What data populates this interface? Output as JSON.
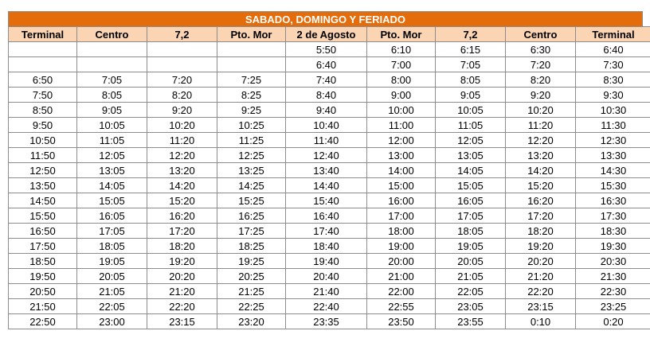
{
  "schedule": {
    "title": "SABADO, DOMINGO Y FERIADO",
    "headers": [
      "Terminal",
      "Centro",
      "7,2",
      "Pto. Mor",
      "2 de Agosto",
      "Pto. Mor",
      "7,2",
      "Centro",
      "Terminal"
    ],
    "rows": [
      [
        "",
        "",
        "",
        "",
        "5:50",
        "6:10",
        "6:15",
        "6:30",
        "6:40"
      ],
      [
        "",
        "",
        "",
        "",
        "6:40",
        "7:00",
        "7:05",
        "7:20",
        "7:30"
      ],
      [
        "6:50",
        "7:05",
        "7:20",
        "7:25",
        "7:40",
        "8:00",
        "8:05",
        "8:20",
        "8:30"
      ],
      [
        "7:50",
        "8:05",
        "8:20",
        "8:25",
        "8:40",
        "9:00",
        "9:05",
        "9:20",
        "9:30"
      ],
      [
        "8:50",
        "9:05",
        "9:20",
        "9:25",
        "9:40",
        "10:00",
        "10:05",
        "10:20",
        "10:30"
      ],
      [
        "9:50",
        "10:05",
        "10:20",
        "10:25",
        "10:40",
        "11:00",
        "11:05",
        "11:20",
        "11:30"
      ],
      [
        "10:50",
        "11:05",
        "11:20",
        "11:25",
        "11:40",
        "12:00",
        "12:05",
        "12:20",
        "12:30"
      ],
      [
        "11:50",
        "12:05",
        "12:20",
        "12:25",
        "12:40",
        "13:00",
        "13:05",
        "13:20",
        "13:30"
      ],
      [
        "12:50",
        "13:05",
        "13:20",
        "13:25",
        "13:40",
        "14:00",
        "14:05",
        "14:20",
        "14:30"
      ],
      [
        "13:50",
        "14:05",
        "14:20",
        "14:25",
        "14:40",
        "15:00",
        "15:05",
        "15:20",
        "15:30"
      ],
      [
        "14:50",
        "15:05",
        "15:20",
        "15:25",
        "15:40",
        "16:00",
        "16:05",
        "16:20",
        "16:30"
      ],
      [
        "15:50",
        "16:05",
        "16:20",
        "16:25",
        "16:40",
        "17:00",
        "17:05",
        "17:20",
        "17:30"
      ],
      [
        "16:50",
        "17:05",
        "17:20",
        "17:25",
        "17:40",
        "18:00",
        "18:05",
        "18:20",
        "18:30"
      ],
      [
        "17:50",
        "18:05",
        "18:20",
        "18:25",
        "18:40",
        "19:00",
        "19:05",
        "19:20",
        "19:30"
      ],
      [
        "18:50",
        "19:05",
        "19:20",
        "19:25",
        "19:40",
        "20:00",
        "20:05",
        "20:20",
        "20:30"
      ],
      [
        "19:50",
        "20:05",
        "20:20",
        "20:25",
        "20:40",
        "21:00",
        "21:05",
        "21:20",
        "21:30"
      ],
      [
        "20:50",
        "21:05",
        "21:20",
        "21:25",
        "21:40",
        "22:00",
        "22:05",
        "22:20",
        "22:30"
      ],
      [
        "21:50",
        "22:05",
        "22:20",
        "22:25",
        "22:40",
        "22:55",
        "23:05",
        "23:15",
        "23:25"
      ],
      [
        "22:50",
        "23:00",
        "23:15",
        "23:20",
        "23:35",
        "23:50",
        "23:55",
        "0:10",
        "0:20"
      ]
    ]
  },
  "colors": {
    "banner_bg": "#e46c0a",
    "banner_text": "#ffffff",
    "header_bg": "#fbd4b4",
    "grid_lines": "#8c8c8c"
  }
}
